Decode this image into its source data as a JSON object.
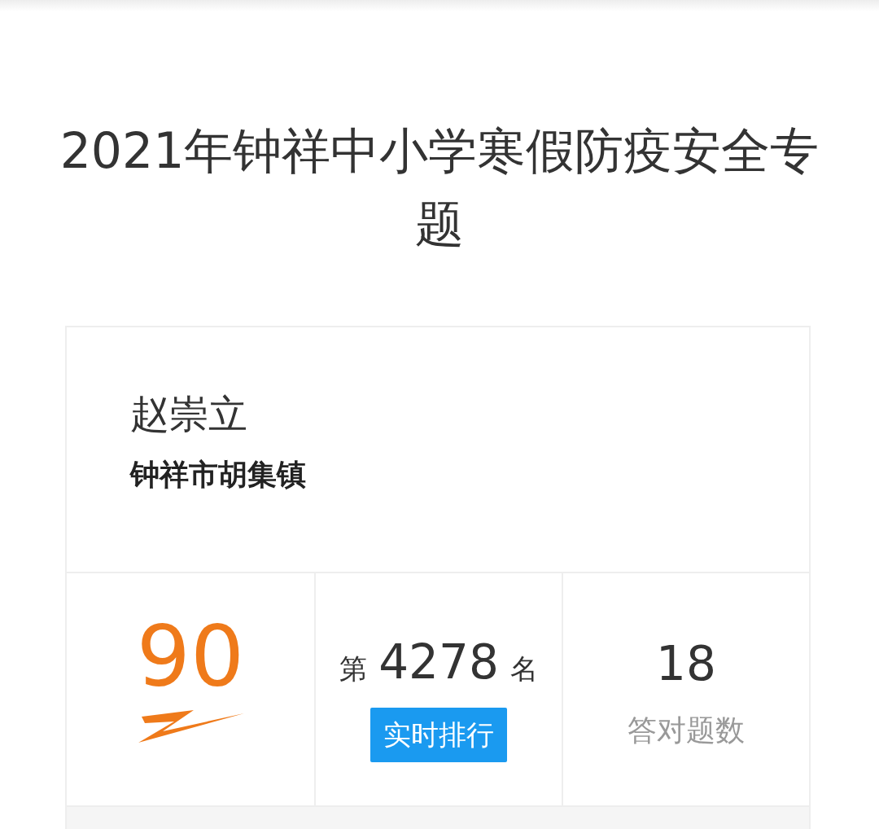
{
  "title": "2021年钟祥中小学寒假防疫安全专题",
  "user": {
    "name": "赵崇立",
    "region": "钟祥市胡集镇"
  },
  "stats": [
    {
      "kind": "score",
      "value": "90"
    },
    {
      "kind": "rank",
      "prefix": "第",
      "value": "4278",
      "suffix": "名",
      "button": "实时排行"
    },
    {
      "kind": "count",
      "value": "18",
      "label": "答对题数"
    }
  ]
}
